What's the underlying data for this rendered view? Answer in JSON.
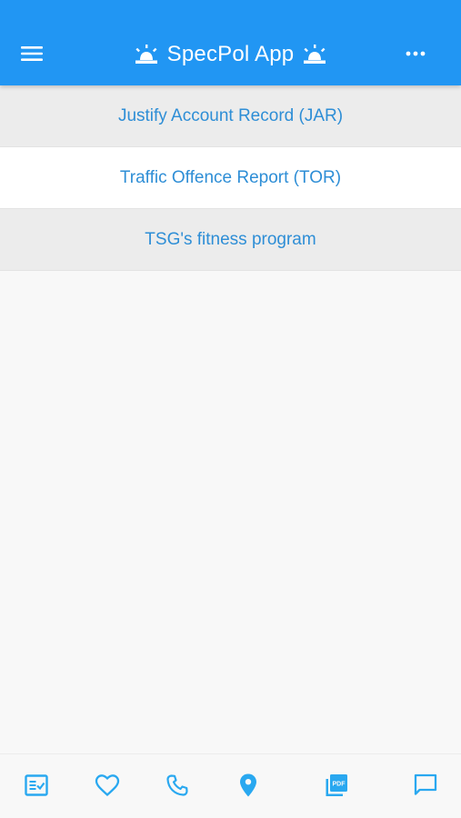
{
  "app_bar": {
    "title": "SpecPol App",
    "left_icon": "menu-icon",
    "right_icon": "more-horizontal-icon",
    "title_icons": [
      "siren-light-icon",
      "siren-light-icon"
    ],
    "background_color": "#2196f3"
  },
  "menu": {
    "items": [
      {
        "label": "Justify Account Record (JAR)"
      },
      {
        "label": "Traffic Offence Report (TOR)"
      },
      {
        "label": "TSG's fitness program"
      }
    ],
    "text_color": "#2e8ed6"
  },
  "bottom_nav": {
    "icons": [
      "checklist-icon",
      "heart-icon",
      "phone-icon",
      "location-pin-icon",
      "pdf-icon",
      "chat-icon"
    ],
    "icon_color": "#29a8f0"
  }
}
